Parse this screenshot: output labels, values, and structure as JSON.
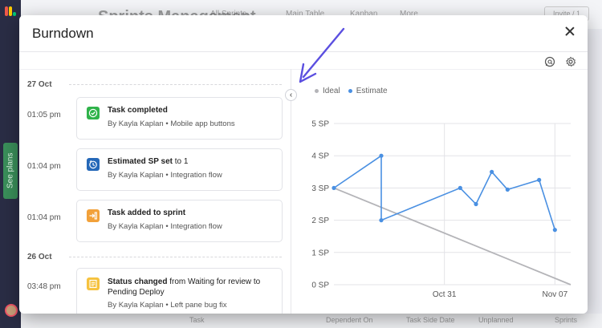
{
  "background": {
    "board_title": "Sprints Management",
    "tabs": [
      "All Sprints",
      "Main Table",
      "Kanban",
      "More"
    ],
    "invite_label": "Invite / 1",
    "see_plans_label": "See plans",
    "bottom_columns": [
      "Task",
      "Dependent On",
      "Task Side Date",
      "Unplanned",
      "Sprints"
    ]
  },
  "modal": {
    "title": "Burndown",
    "close_icon": "close-icon",
    "toolbar_icons": [
      "chat-search-icon",
      "gear-icon"
    ],
    "collapse_icon": "chevron-left-icon"
  },
  "activity": {
    "groups": [
      {
        "date": "27 Oct",
        "items": [
          {
            "time": "01:05 pm",
            "title_bold": "Task completed",
            "title_rest": "",
            "by": "By Kayla Kaplan",
            "sep": "•",
            "context": "Mobile app buttons",
            "icon": "check-icon",
            "color": "#2fb34a"
          },
          {
            "time": "01:04 pm",
            "title_bold": "Estimated SP set",
            "title_rest": " to 1",
            "by": "By Kayla Kaplan",
            "sep": "•",
            "context": "Integration flow",
            "icon": "timer-icon",
            "color": "#2568b8"
          },
          {
            "time": "01:04 pm",
            "title_bold": "Task added to sprint",
            "title_rest": "",
            "by": "By Kayla Kaplan",
            "sep": "•",
            "context": "Integration flow",
            "icon": "add-to-sprint-icon",
            "color": "#f2a13a"
          }
        ]
      },
      {
        "date": "26 Oct",
        "items": [
          {
            "time": "03:48 pm",
            "title_bold": "Status changed",
            "title_rest": " from Waiting for review to Pending Deploy",
            "by": "By Kayla Kaplan",
            "sep": "•",
            "context": "Left pane bug fix",
            "icon": "list-icon",
            "color": "#f6c23e"
          }
        ]
      }
    ]
  },
  "chart_data": {
    "type": "line",
    "legend": [
      {
        "name": "Ideal",
        "color": "#b4b4b8"
      },
      {
        "name": "Estimate",
        "color": "#4a90e2"
      }
    ],
    "y_ticks": [
      "0 SP",
      "1 SP",
      "2 SP",
      "3 SP",
      "4 SP",
      "5 SP"
    ],
    "ylim": [
      0,
      5
    ],
    "x_ticks": [
      "Oct 31",
      "Nov 07"
    ],
    "xlim": [
      "Oct 24",
      "Nov 08"
    ],
    "grid": true,
    "series": [
      {
        "name": "Ideal",
        "color": "#b4b4b8",
        "markers": false,
        "x": [
          "Oct 24",
          "Nov 08"
        ],
        "y": [
          3,
          0
        ]
      },
      {
        "name": "Estimate",
        "color": "#4a90e2",
        "markers": true,
        "x": [
          "Oct 24",
          "Oct 27",
          "Oct 27",
          "Nov 01",
          "Nov 02",
          "Nov 03",
          "Nov 04",
          "Nov 06",
          "Nov 07"
        ],
        "y": [
          3,
          4,
          2,
          3,
          2.5,
          3.5,
          2.95,
          3.25,
          1.7
        ]
      }
    ]
  }
}
